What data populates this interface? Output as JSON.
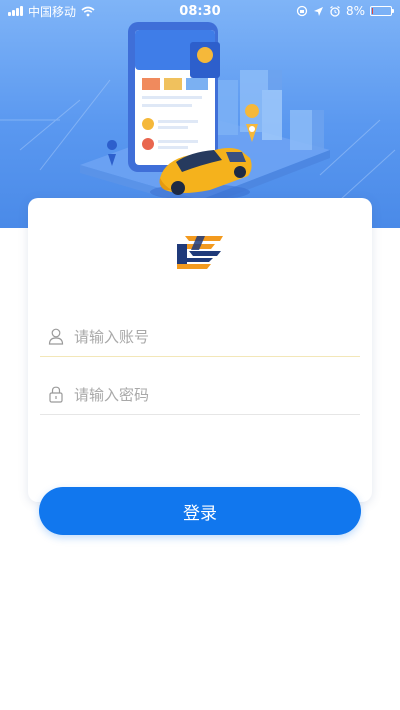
{
  "status_bar": {
    "carrier": "中国移动",
    "time": "08:30",
    "battery": "8%",
    "battery_level": 0.08
  },
  "form": {
    "account_placeholder": "请输入账号",
    "password_placeholder": "请输入密码",
    "account_value": "",
    "password_value": ""
  },
  "login_button": {
    "label": "登录"
  },
  "colors": {
    "primary": "#1177ee",
    "hero_top": "#7fb4f7",
    "hero_bottom": "#4a8ae8",
    "logo_orange": "#f39a1e",
    "logo_navy": "#1f3a7a"
  },
  "icons": [
    "wifi-icon",
    "alarm-icon",
    "location-arrow-icon",
    "user-icon",
    "lock-icon"
  ]
}
